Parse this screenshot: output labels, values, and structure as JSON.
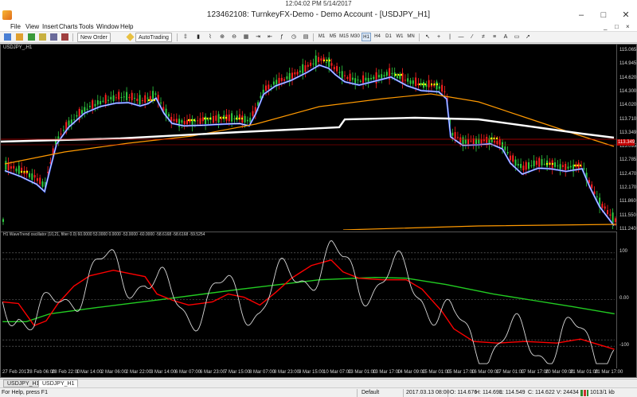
{
  "clock": "12:04:02 PM 5/14/2017",
  "window": {
    "title": "123462108: TurnkeyFX-Demo - Demo Account - [USDJPY_H1]",
    "controls": [
      "–",
      "□",
      "✕"
    ]
  },
  "menu": {
    "items": [
      "File",
      "View",
      "Insert",
      "Charts",
      "Tools",
      "Window",
      "Help"
    ],
    "mdi_controls": [
      "_",
      "□",
      "×"
    ]
  },
  "toolbar": {
    "new_order_label": "New Order",
    "autotrading_label": "AutoTrading",
    "timeframes": [
      "M1",
      "M5",
      "M15",
      "M30",
      "H1",
      "H4",
      "D1",
      "W1",
      "MN"
    ],
    "active_timeframe": "H1"
  },
  "chart": {
    "symbol_label": "USDJPY_,H1",
    "oscillator_label": "H1 WaveTrend oscillator (10,21, filter 0.0) 60.0000 53.0000 0.0000 -53.0000 -60.0000 -58.6168 -58.6168 -59.5254",
    "price_labels": [
      "115.065",
      "114.945",
      "114.620",
      "114.300",
      "114.020",
      "113.710",
      "113.349",
      "113.095",
      "112.785",
      "112.470",
      "112.170",
      "111.860",
      "111.550",
      "111.240"
    ],
    "bid_price": "113.349",
    "osc_labels": [
      "100",
      "0.00",
      "-100"
    ],
    "time_labels": [
      "27 Feb 2017",
      "28 Feb 06:00",
      "28 Feb 22:00",
      "1 Mar 14:00",
      "2 Mar 06:00",
      "2 Mar 22:00",
      "3 Mar 14:00",
      "6 Mar 07:00",
      "6 Mar 23:00",
      "7 Mar 15:00",
      "8 Mar 07:00",
      "8 Mar 23:00",
      "9 Mar 15:00",
      "10 Mar 07:00",
      "13 Mar 01:00",
      "13 Mar 17:00",
      "14 Mar 09:00",
      "15 Mar 01:00",
      "15 Mar 17:00",
      "16 Mar 09:00",
      "17 Mar 01:00",
      "17 Mar 17:00",
      "20 Mar 09:00",
      "21 Mar 01:00",
      "21 Mar 17:00"
    ],
    "colors": {
      "background": "#000000",
      "bull_candle": "#2ecc40",
      "bear_candle": "#ff2020",
      "fast_ma": "#ffffff",
      "medium_ma": "#ff9900",
      "slow_ma": "#ffffff",
      "trend_band": "#3355ff",
      "signal_marks": "#ffff00",
      "osc_wave": "#d9d9d9",
      "osc_signal": "#ff0000",
      "osc_trend": "#22cc22"
    }
  },
  "tabs": [
    {
      "label": "USDJPY_H1",
      "active": false
    },
    {
      "label": "USDJPY_H1",
      "active": true
    }
  ],
  "status": {
    "help": "For Help, press F1",
    "profile": "Default",
    "datetime": "2017.03.13 08:00",
    "open": "O: 114.676",
    "high": "H: 114.693",
    "low": "L: 114.549",
    "close": "C: 114.622",
    "volume": "V: 24434",
    "traffic": "1013/1 kb"
  }
}
